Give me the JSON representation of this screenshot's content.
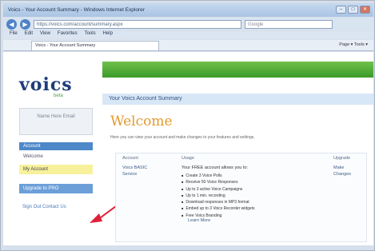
{
  "window": {
    "title": "Voics - Your Account Summary - Windows Internet Explorer",
    "minimize": "–",
    "maximize": "□",
    "close": "✕"
  },
  "address": {
    "url": "https://voics.com/account/summary.aspx",
    "search_placeholder": "Google",
    "back": "◀",
    "forward": "▶"
  },
  "menu": [
    "File",
    "Edit",
    "View",
    "Favorites",
    "Tools",
    "Help"
  ],
  "tab": {
    "label": "Voics - Your Account Summary"
  },
  "commandbar": {
    "text": "Page ▾  Tools ▾"
  },
  "logo": {
    "text": "voics",
    "sub": "beta"
  },
  "sidebar": {
    "box_text": "Name Here Email",
    "header": "Account",
    "items": [
      {
        "label": "Welcome",
        "active": false
      },
      {
        "label": "My Account",
        "active": true
      }
    ],
    "blue_button": "Upgrade to PRO",
    "links": "Sign Out   Contact Us"
  },
  "content": {
    "title": "Your Voics Account Summary",
    "welcome": "Welcome",
    "desc": "Here you can view your account and make changes to your features and settings."
  },
  "table": {
    "headers": [
      "Account",
      "Usage",
      "Upgrade"
    ],
    "account": [
      "Voics BASIC",
      "Service"
    ],
    "usage_intro": "Your FREE account allows you to:",
    "bullets": [
      "Create 3 Voice Polls",
      "Receive 50 Voice Responses",
      "Up to 3 active Voice Campaigns",
      "Up to 1 min. recording",
      "Download responses in MP3 format",
      "Embed up to 3 Voics Recorder widgets",
      "Free Voics Branding"
    ],
    "more_link": "Learn More",
    "upgrade": [
      "Make",
      "Changes"
    ]
  },
  "colors": {
    "green": "#3c9a2a",
    "accent_orange": "#e39a2c",
    "arrow": "#e0203a"
  }
}
